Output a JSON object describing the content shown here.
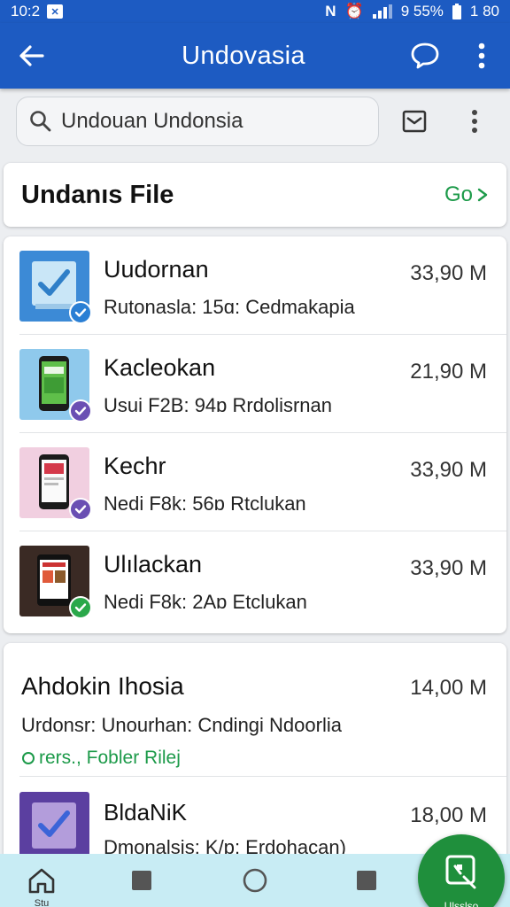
{
  "status_bar": {
    "time": "10:2",
    "signal_text": "9 55%",
    "battery_text": "1 80"
  },
  "app_bar": {
    "title": "Undovasia"
  },
  "search": {
    "value": "Undouan Undonsia"
  },
  "section": {
    "title": "Undanıs File",
    "go_label": "Go"
  },
  "files": [
    {
      "name": "Uudornan",
      "meta": "Rutonasla: 15ɑ: Cedmakapia",
      "size": "33,90 M",
      "thumb_color": "#3c8ad6",
      "check_color": "#2a7fd4"
    },
    {
      "name": "Kacleokan",
      "meta": "Usui F2B: 94ɒ  Rrdolisrnan",
      "size": "21,90 M",
      "thumb_color": "#8fc9ec",
      "check_color": "#6a4fb3"
    },
    {
      "name": "Kechr",
      "meta": "Nedi F8k: 56ɒ  Rtclukan",
      "size": "33,90 M",
      "thumb_color": "#f1cfe0",
      "check_color": "#6a4fb3"
    },
    {
      "name": "Ulılackan",
      "meta": "Nedi F8k: 2Aɒ  Etclukan",
      "size": "33,90 M",
      "thumb_color": "#3a2a24",
      "check_color": "#2aa84a"
    }
  ],
  "card2": {
    "title": "Ahdokin Ihosia",
    "size": "14,00 M",
    "subtitle": "Urdonsr: Unourhan: Cndingi Ndoorlia",
    "link": "rers., Fobler Rilej",
    "item": {
      "name": "BldaNiK",
      "meta": "Dmonalsis: K/ɒ: Erdohacan)",
      "size": "18,00 M"
    }
  },
  "nav": {
    "home_label": "Stu",
    "fab_label": "Ulsslso"
  },
  "colors": {
    "primary": "#1d5bc2",
    "accent_green": "#1c9a49",
    "nav_bg": "#c8ecf4"
  }
}
